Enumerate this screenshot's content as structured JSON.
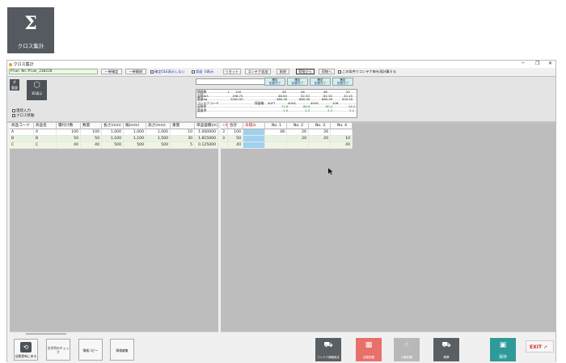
{
  "app_tile": {
    "symbol": "Σ",
    "label": "クロス集計"
  },
  "window": {
    "title": "クロス集計",
    "minimize": "─",
    "maximize": "❐",
    "close": "✕"
  },
  "toolbar": {
    "plan_name": "Plan No:Plan_230228",
    "buttons": [
      "一単確定",
      "一単解除",
      "リセット",
      "コンテナ追加",
      "削除",
      "荷物から",
      "荷物へ"
    ],
    "checkbox_hide_confirmed": "確定OLE表示しない",
    "checkbox_cross": "背面",
    "checkbox_zero": "0表示",
    "checkbox_recompute": "この条件でコンテナ毎を再計算する"
  },
  "left_panel": {
    "small_icon_label": "重量",
    "big_icon_label": "3D表示",
    "checkbox_continuous": "連続入力",
    "checkbox_cross_move": "クロス移動"
  },
  "info_grid": {
    "labels": [
      "積載数",
      "容積m3",
      "重量kg",
      "コンテナコード",
      "容積率",
      "重量率"
    ],
    "left_values": [
      "1",
      "100",
      "196.75",
      "2000.00"
    ],
    "container_code_label": "保留箱",
    "containers": [
      {
        "status": "確定",
        "substatus": "配置完了",
        "count": "48",
        "volume": "48.00",
        "weight": "480.00",
        "code": "40HC",
        "vol_rate": "72.8",
        "wt_rate": "1.9"
      },
      {
        "status": "確定",
        "substatus": "配置完了",
        "count": "46",
        "volume": "52.30",
        "weight": "880.00",
        "code": "40HC",
        "vol_rate": "86.6",
        "wt_rate": "3.3"
      },
      {
        "status": "確定",
        "substatus": "配置完了",
        "count": "46",
        "volume": "62.30",
        "weight": "880.00",
        "code": "40HQ",
        "vol_rate": "80.4",
        "wt_rate": "3.3"
      },
      {
        "status": "確定",
        "substatus": "配置完了",
        "count": "50",
        "volume": "20.15",
        "weight": "500.00",
        "code": "10ft",
        "vol_rate": "46.6",
        "wt_rate": "5.0"
      }
    ],
    "first_code": "40FT"
  },
  "left_table": {
    "columns": [
      "商品コード",
      "商品名",
      "積付け数",
      "数量",
      "長さ(mm)",
      "幅(mm)",
      "高さ(mm)",
      "重量",
      "単品容積(m3)"
    ],
    "rows": [
      [
        "A",
        "A",
        "100",
        "100",
        "1,000",
        "1,000",
        "1,000",
        "10",
        "1.000000"
      ],
      [
        "B",
        "B",
        "50",
        "50",
        "1,100",
        "1,100",
        "1,500",
        "30",
        "1.815000"
      ],
      [
        "C",
        "C",
        "40",
        "40",
        "500",
        "500",
        "500",
        "5",
        "0.125000"
      ]
    ]
  },
  "right_table": {
    "columns": [
      "+確",
      "合計",
      "未積み",
      "No. 1",
      "No. 2",
      "No. 3",
      "No. 4"
    ],
    "rows": [
      [
        "3",
        "100",
        "",
        "48",
        "26",
        "26",
        ""
      ],
      [
        "3",
        "50",
        "",
        "",
        "20",
        "20",
        "10"
      ],
      [
        "",
        "40",
        "",
        "",
        "",
        "",
        "40"
      ]
    ]
  },
  "bottom": {
    "btn_history": "自動更新に戻る",
    "btn_char_check": "文字列のチェック",
    "btn_copy": "情報コピー",
    "btn_edit": "情報編集",
    "btn_container_config": "コンテナ情報設定",
    "btn_layout": "自動配置",
    "btn_manual": "手動配置",
    "btn_print": "帳票",
    "btn_save": "保存",
    "btn_exit": "EXIT"
  },
  "colors": {
    "plan_bg": "#e9f8e4",
    "row_a": "#ffffff",
    "row_b": "#e7f3df",
    "row_c": "#f4f3e3",
    "unloaded_cell": "#9fd2ef",
    "layout_btn": "#e9706a",
    "save_btn": "#2e9a9a",
    "exit_arrow": "#d62b2b"
  }
}
